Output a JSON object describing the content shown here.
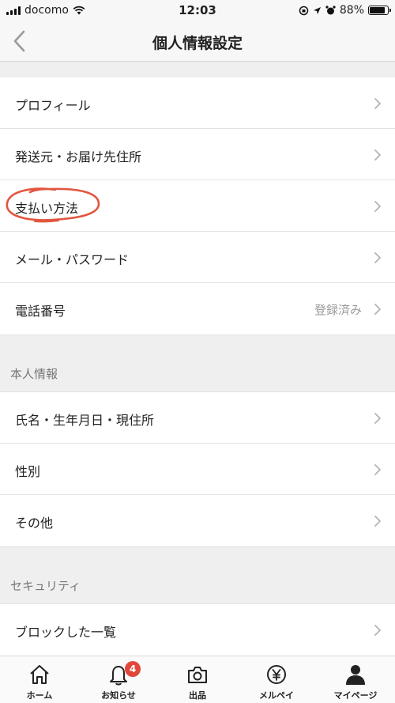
{
  "status_bar": {
    "carrier": "docomo",
    "time": "12:03",
    "battery": "88%",
    "battery_level": 0.88
  },
  "nav": {
    "title": "個人情報設定"
  },
  "groups": [
    {
      "header": "",
      "rows": [
        {
          "label": "プロフィール",
          "value": ""
        },
        {
          "label": "発送元・お届け先住所",
          "value": ""
        },
        {
          "label": "支払い方法",
          "value": ""
        },
        {
          "label": "メール・パスワード",
          "value": ""
        },
        {
          "label": "電話番号",
          "value": "登録済み"
        }
      ]
    },
    {
      "header": "本人情報",
      "rows": [
        {
          "label": "氏名・生年月日・現住所",
          "value": ""
        },
        {
          "label": "性別",
          "value": ""
        },
        {
          "label": "その他",
          "value": ""
        }
      ]
    },
    {
      "header": "セキュリティ",
      "rows": [
        {
          "label": "ブロックした一覧",
          "value": ""
        }
      ]
    }
  ],
  "annotation": {
    "circled_item": "支払い方法",
    "color": "#e2553f"
  },
  "tab_bar": {
    "tabs": [
      {
        "label": "ホーム",
        "icon": "home-icon"
      },
      {
        "label": "お知らせ",
        "icon": "bell-icon",
        "badge": "4"
      },
      {
        "label": "出品",
        "icon": "camera-icon"
      },
      {
        "label": "メルペイ",
        "icon": "yen-icon"
      },
      {
        "label": "マイページ",
        "icon": "person-icon"
      }
    ]
  },
  "colors": {
    "badge": "#e0473a",
    "annotation": "#e2553f",
    "secondary_text": "#9a9a9a"
  }
}
